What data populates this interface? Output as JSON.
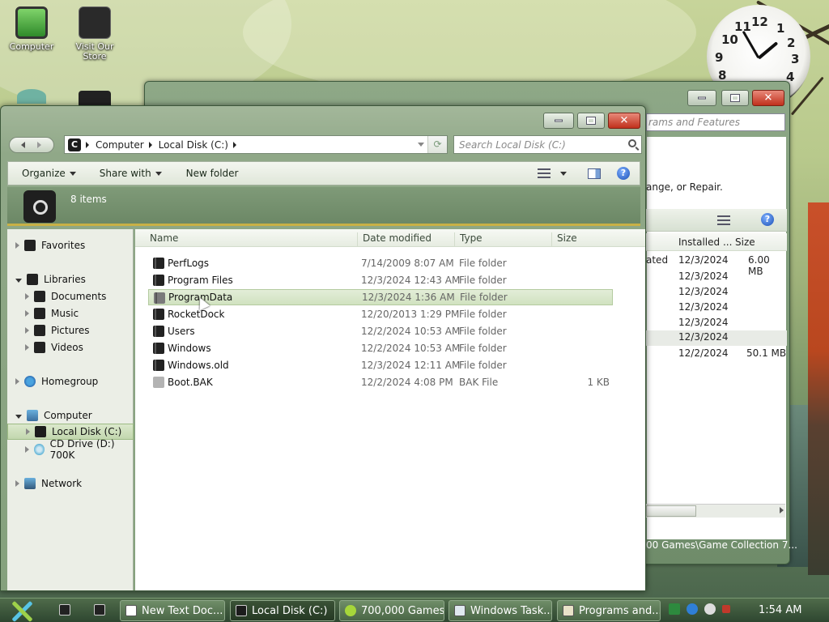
{
  "desktop": {
    "icons": [
      {
        "label": "Computer"
      },
      {
        "label": "Visit Our Store"
      }
    ],
    "clock": {
      "numbers": [
        "12",
        "1",
        "2",
        "3",
        "4",
        "8",
        "9",
        "10",
        "11"
      ]
    }
  },
  "background_window": {
    "search_text": "rams and Features",
    "description": "ange, or Repair.",
    "columns": [
      "Installed ...",
      "Size"
    ],
    "rows": [
      {
        "publisher": "ated",
        "installed": "12/3/2024",
        "size": "6.00 MB"
      },
      {
        "publisher": "",
        "installed": "12/3/2024",
        "size": ""
      },
      {
        "publisher": "",
        "installed": "12/3/2024",
        "size": ""
      },
      {
        "publisher": "",
        "installed": "12/3/2024",
        "size": ""
      },
      {
        "publisher": "",
        "installed": "12/3/2024",
        "size": ""
      },
      {
        "publisher": "",
        "installed": "12/3/2024",
        "size": ""
      },
      {
        "publisher": "",
        "installed": "12/2/2024",
        "size": "50.1 MB"
      }
    ],
    "status_text": "00 Games\\Game Collection 7..."
  },
  "explorer": {
    "breadcrumb": [
      "Computer",
      "Local Disk (C:)"
    ],
    "drive_letter": "C",
    "search_placeholder": "Search Local Disk (C:)",
    "toolbar": {
      "organize": "Organize",
      "share_with": "Share with",
      "new_folder": "New folder"
    },
    "details": {
      "item_count": "8 items"
    },
    "columns": {
      "name": "Name",
      "date": "Date modified",
      "type": "Type",
      "size": "Size"
    },
    "files": [
      {
        "name": "PerfLogs",
        "date": "7/14/2009 8:07 AM",
        "type": "File folder",
        "size": ""
      },
      {
        "name": "Program Files",
        "date": "12/3/2024 12:43 AM",
        "type": "File folder",
        "size": ""
      },
      {
        "name": "ProgramData",
        "date": "12/3/2024 1:36 AM",
        "type": "File folder",
        "size": ""
      },
      {
        "name": "RocketDock",
        "date": "12/20/2013 1:29 PM",
        "type": "File folder",
        "size": ""
      },
      {
        "name": "Users",
        "date": "12/2/2024 10:53 AM",
        "type": "File folder",
        "size": ""
      },
      {
        "name": "Windows",
        "date": "12/2/2024 10:53 AM",
        "type": "File folder",
        "size": ""
      },
      {
        "name": "Windows.old",
        "date": "12/3/2024 12:11 AM",
        "type": "File folder",
        "size": ""
      },
      {
        "name": "Boot.BAK",
        "date": "12/2/2024 4:08 PM",
        "type": "BAK File",
        "size": "1 KB"
      }
    ],
    "nav": {
      "favorites": "Favorites",
      "libraries": "Libraries",
      "documents": "Documents",
      "music": "Music",
      "pictures": "Pictures",
      "videos": "Videos",
      "homegroup": "Homegroup",
      "computer": "Computer",
      "local_disk": "Local Disk (C:)",
      "cd_drive": "CD Drive (D:) 700K",
      "network": "Network"
    }
  },
  "taskbar": {
    "buttons": [
      {
        "label": "New Text Doc..."
      },
      {
        "label": "Local Disk (C:)"
      },
      {
        "label": "700,000 Games"
      },
      {
        "label": "Windows Task..."
      },
      {
        "label": "Programs and..."
      }
    ],
    "time": "1:54 AM"
  },
  "colors": {
    "accent": "#6f8c6a",
    "selection": "#d1e2c0",
    "close_button": "#c0301c"
  }
}
